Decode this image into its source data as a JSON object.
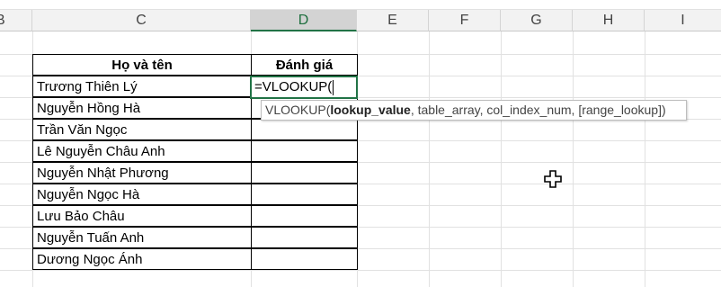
{
  "columns": [
    "B",
    "C",
    "D",
    "E",
    "F",
    "G",
    "H",
    "I"
  ],
  "selected_column": "D",
  "table": {
    "header_name": "Họ và tên",
    "header_rating": "Đánh giá",
    "names": [
      "Trương Thiên Lý",
      "Nguyễn Hồng Hà",
      "Trần Văn Ngọc",
      "Lê Nguyễn Châu Anh",
      "Nguyễn Nhật Phương",
      "Nguyễn Ngọc Hà",
      "Lưu Bảo Châu",
      "Nguyễn Tuấn Anh",
      "Dương Ngọc Ánh"
    ]
  },
  "active_cell": {
    "value": "=VLOOKUP("
  },
  "tooltip": {
    "function_name": "VLOOKUP(",
    "current_arg": "lookup_value",
    "rest": ", table_array, col_index_num, [range_lookup])"
  },
  "cursor_icon": "cell-select-cross-icon",
  "colors": {
    "selection_green": "#217346",
    "header_bg": "#f2f2f2",
    "gridline": "#e1e1e1"
  }
}
